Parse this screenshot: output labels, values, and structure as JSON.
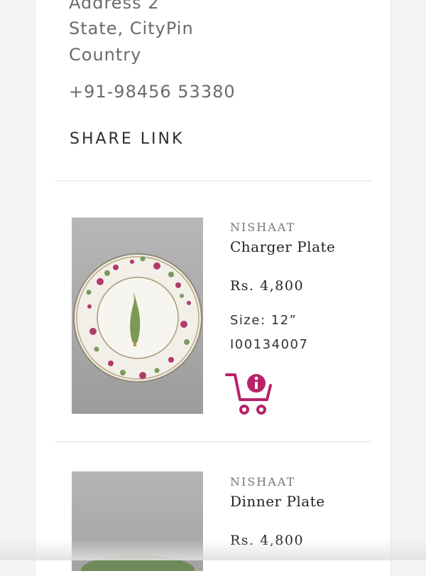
{
  "address": {
    "line1": "Address 2",
    "line2": "State, CityPin",
    "line3": "Country",
    "phone": "+91-98456 53380"
  },
  "share_link_label": "SHARE LINK",
  "products": [
    {
      "brand": "NISHAAT",
      "name": "Charger Plate",
      "price": "Rs. 4,800",
      "size": "Size: 12”",
      "sku": "I00134007",
      "cart_icon": "cart-info-icon"
    },
    {
      "brand": "NISHAAT",
      "name": "Dinner Plate",
      "price": "Rs. 4,800"
    }
  ],
  "colors": {
    "accent": "#b8236a",
    "text_gray": "#6b6b6b",
    "divider": "#e2e2e2"
  }
}
